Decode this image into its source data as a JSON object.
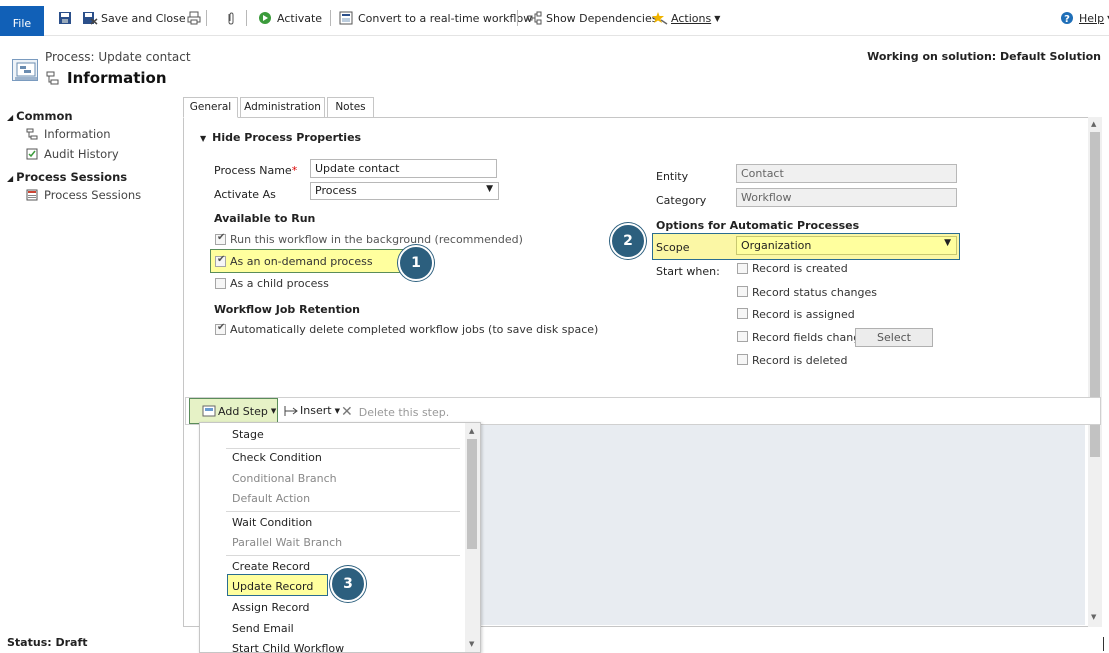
{
  "ribbon": {
    "file": "File",
    "save_close": "Save and Close",
    "activate": "Activate",
    "convert": "Convert to a real-time workflow",
    "show_deps": "Show Dependencies",
    "actions": "Actions",
    "help": "Help"
  },
  "header": {
    "subtitle": "Process: Update contact",
    "title": "Information",
    "solution": "Working on solution: Default Solution"
  },
  "sidebar": {
    "common": "Common",
    "information": "Information",
    "audit_history": "Audit History",
    "process_sessions_header": "Process Sessions",
    "process_sessions": "Process Sessions"
  },
  "tabs": [
    "General",
    "Administration",
    "Notes"
  ],
  "form": {
    "section_toggle": "Hide Process Properties",
    "process_name_label": "Process Name",
    "required_mark": "*",
    "process_name_value": "Update contact",
    "activate_as_label": "Activate As",
    "activate_as_value": "Process",
    "available_to_run": "Available to Run",
    "run_background": "Run this workflow in the background (recommended)",
    "on_demand": "As an on-demand process",
    "child_process": "As a child process",
    "retention_header": "Workflow Job Retention",
    "auto_delete": "Automatically delete completed workflow jobs (to save disk space)",
    "entity_label": "Entity",
    "entity_value": "Contact",
    "category_label": "Category",
    "category_value": "Workflow",
    "options_header": "Options for Automatic Processes",
    "scope_label": "Scope",
    "scope_value": "Organization",
    "start_when_label": "Start when:",
    "record_created": "Record is created",
    "record_status": "Record status changes",
    "record_assigned": "Record is assigned",
    "record_fields": "Record fields change",
    "select_btn": "Select",
    "record_deleted": "Record is deleted"
  },
  "steps_toolbar": {
    "add_step": "Add Step",
    "insert": "Insert",
    "delete": "Delete this step."
  },
  "add_step_menu": [
    {
      "label": "Stage",
      "enabled": true
    },
    {
      "label": "Check Condition",
      "enabled": true
    },
    {
      "label": "Conditional Branch",
      "enabled": false
    },
    {
      "label": "Default Action",
      "enabled": false
    },
    {
      "label": "Wait Condition",
      "enabled": true
    },
    {
      "label": "Parallel Wait Branch",
      "enabled": false
    },
    {
      "label": "Create Record",
      "enabled": true
    },
    {
      "label": "Update Record",
      "enabled": true
    },
    {
      "label": "Assign Record",
      "enabled": true
    },
    {
      "label": "Send Email",
      "enabled": true
    },
    {
      "label": "Start Child Workflow",
      "enabled": true
    }
  ],
  "callouts": [
    "1",
    "2",
    "3"
  ],
  "status": "Status: Draft",
  "colors": {
    "file_blue": "#1160b7",
    "highlight": "#ffff9e",
    "callout": "#2c5f7e"
  }
}
